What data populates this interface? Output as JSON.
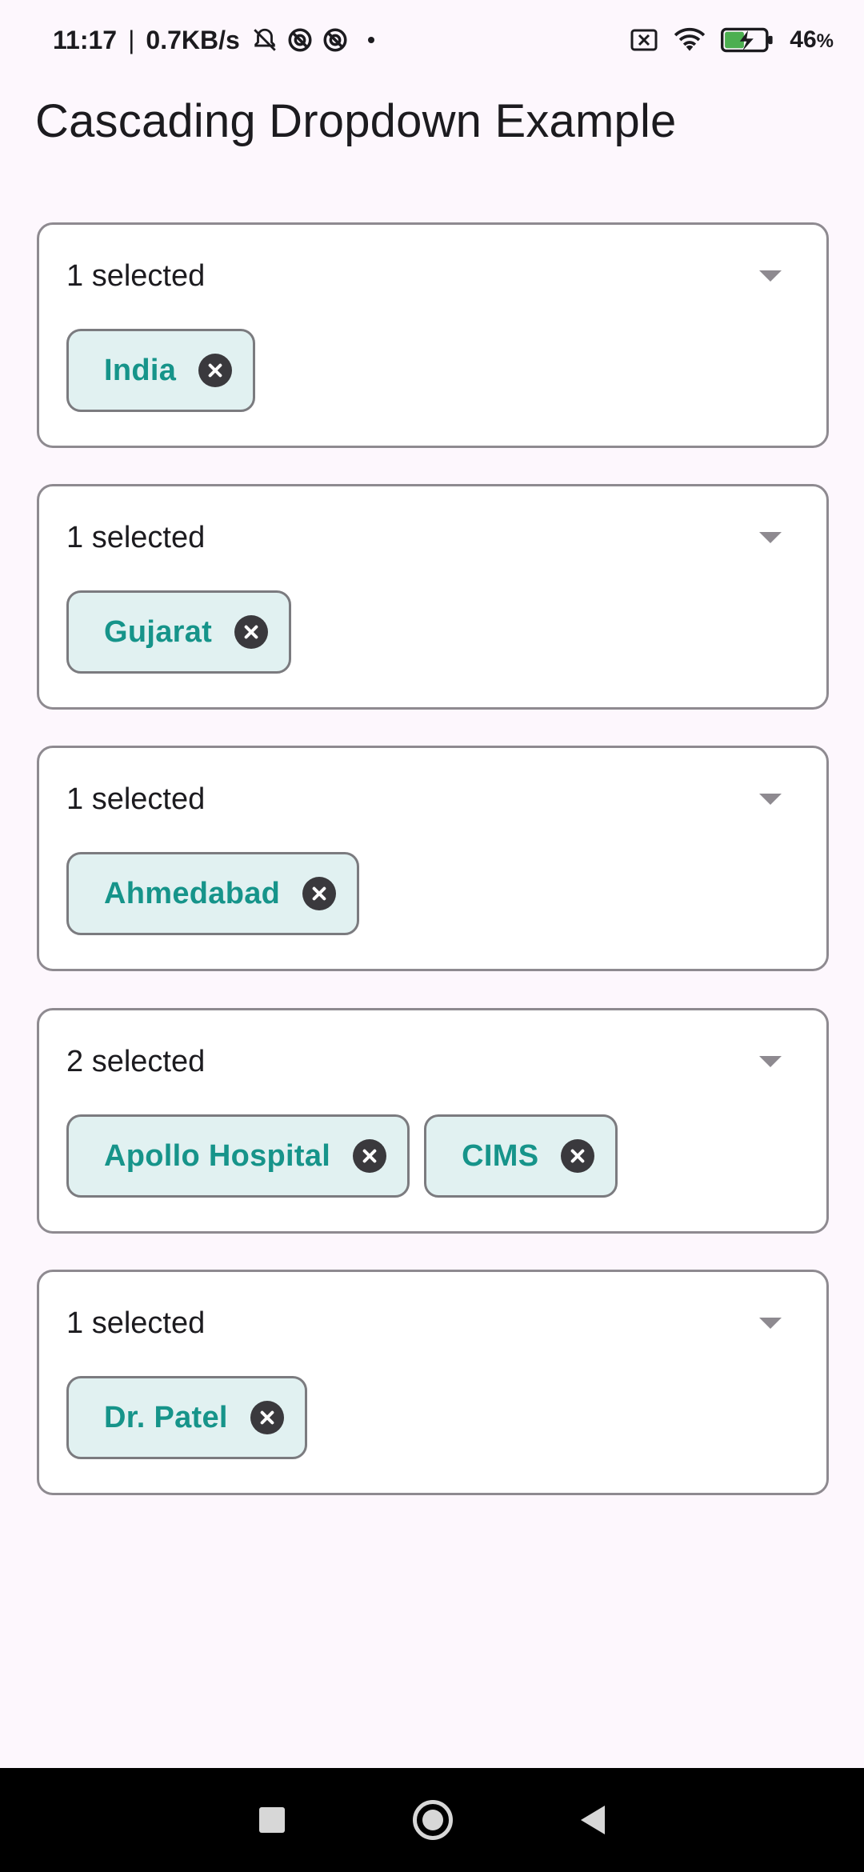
{
  "status_bar": {
    "time": "11:17",
    "separator": "|",
    "net_speed": "0.7KB/s",
    "battery_level": "46",
    "battery_unit": "%",
    "icons_left": [
      "muted-bell-icon",
      "data-saver-icon",
      "data-saver-icon"
    ],
    "icons_right": [
      "sim-off-icon",
      "wifi-icon",
      "battery-charging-icon"
    ]
  },
  "app": {
    "title": "Cascading Dropdown Example"
  },
  "dropdowns": [
    {
      "selected_label": "1 selected",
      "chips": [
        "India"
      ]
    },
    {
      "selected_label": "1 selected",
      "chips": [
        "Gujarat"
      ]
    },
    {
      "selected_label": "1 selected",
      "chips": [
        "Ahmedabad"
      ]
    },
    {
      "selected_label": "2 selected",
      "chips": [
        "Apollo Hospital",
        "CIMS"
      ]
    },
    {
      "selected_label": "1 selected",
      "chips": [
        "Dr. Patel"
      ]
    }
  ],
  "colors": {
    "background": "#fdf7fd",
    "chip_background": "#e1f1f1",
    "chip_text": "#16948a",
    "border": "#8e8a90"
  }
}
